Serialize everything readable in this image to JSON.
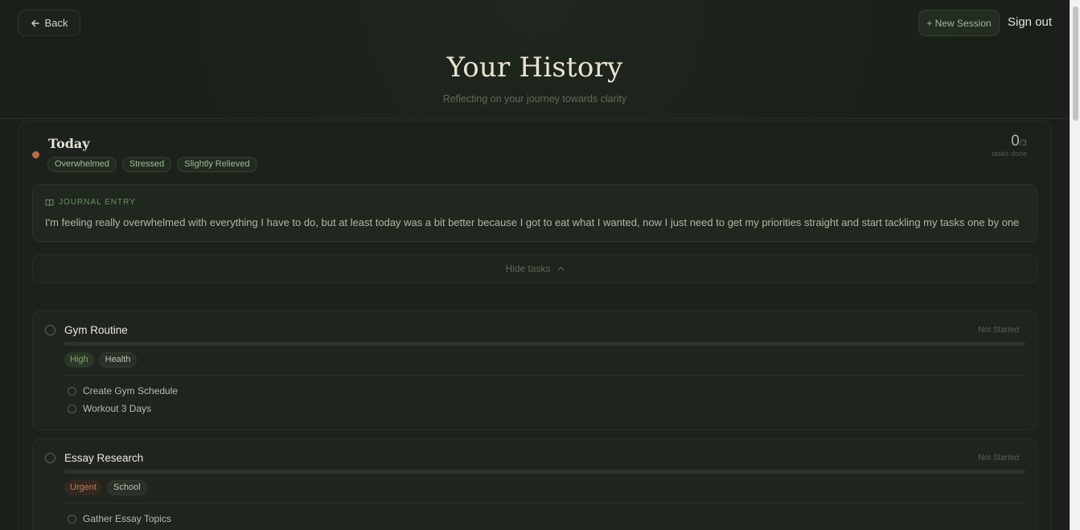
{
  "header": {
    "back_label": "Back",
    "new_session_label": "+ New Session",
    "sign_out_label": "Sign out",
    "title": "Your History",
    "subtitle": "Reflecting on your journey towards clarity"
  },
  "entry": {
    "day": "Today",
    "moods": [
      "Overwhelmed",
      "Stressed",
      "Slightly Relieved"
    ],
    "tasks_done": "0",
    "tasks_total": "/3",
    "tasks_done_label": "tasks done",
    "journal_label": "JOURNAL ENTRY",
    "journal_text": "I'm feeling really overwhelmed with everything I have to do, but at least today was a bit better because I got to eat what I wanted, now I just need to get my priorities straight and start tackling my tasks one by one",
    "hide_tasks_label": "Hide tasks",
    "tasks": [
      {
        "name": "Gym Routine",
        "status": "Not Started",
        "progress": 0,
        "priority": "High",
        "category": "Health",
        "subtasks": [
          "Create Gym Schedule",
          "Workout 3 Days"
        ]
      },
      {
        "name": "Essay Research",
        "status": "Not Started",
        "progress": 0,
        "priority": "Urgent",
        "category": "School",
        "subtasks": [
          "Gather Essay Topics"
        ]
      }
    ]
  },
  "colors": {
    "background": "#1a1f19",
    "accent_green": "#9fb79a",
    "mood_dot": "#b86b47",
    "urgent": "#c27a55"
  }
}
